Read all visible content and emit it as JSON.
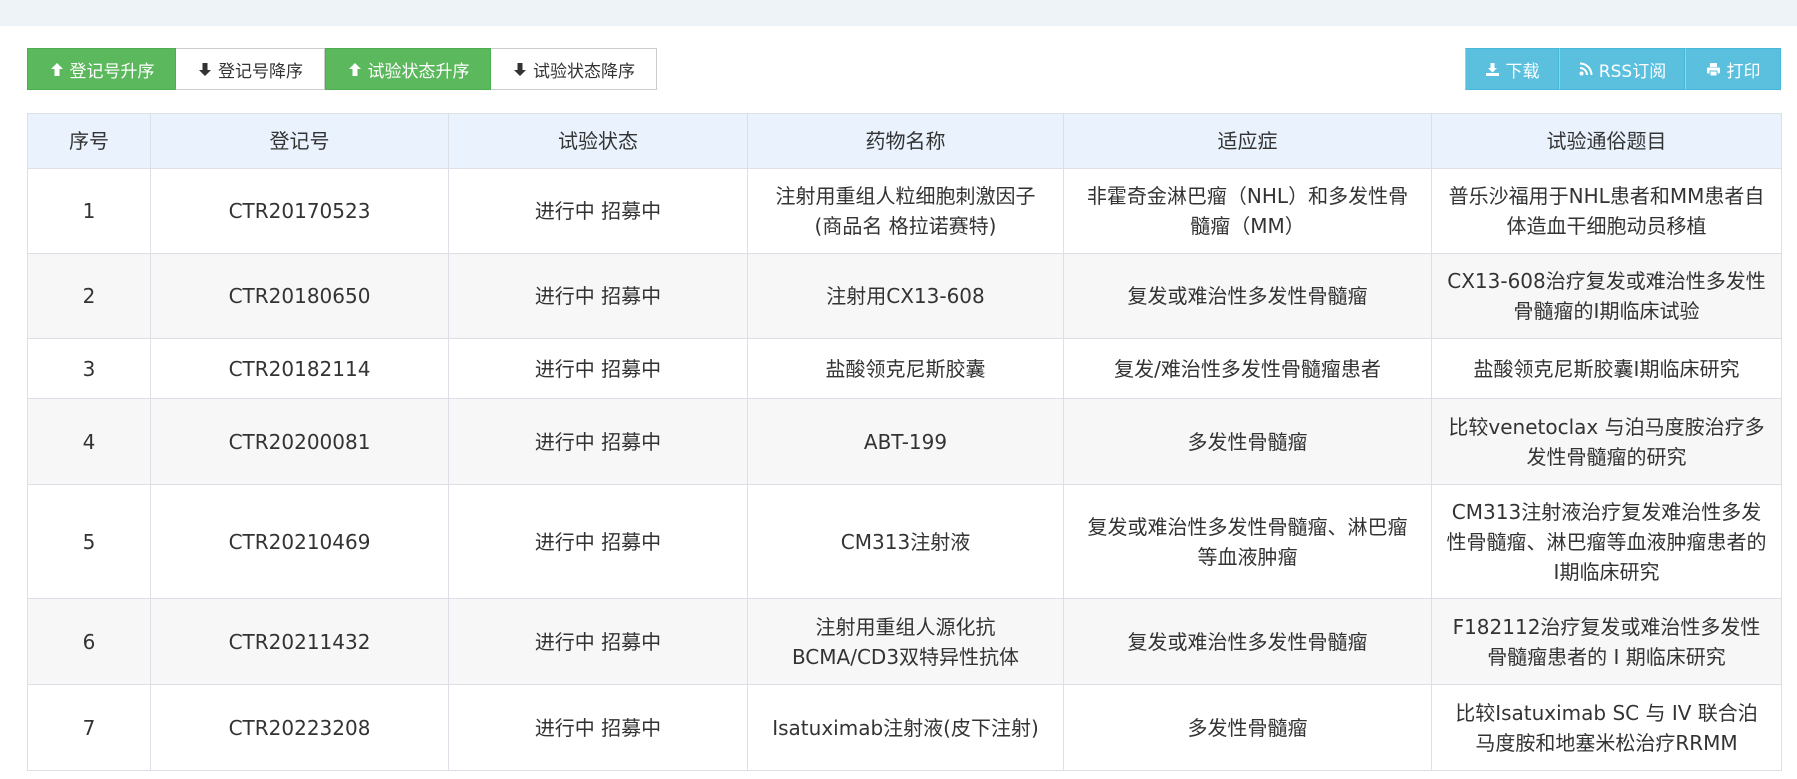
{
  "toolbar": {
    "sort_buttons": [
      {
        "label": "登记号升序",
        "icon": "arrow-up-icon",
        "active": true
      },
      {
        "label": "登记号降序",
        "icon": "arrow-down-icon",
        "active": false
      },
      {
        "label": "试验状态升序",
        "icon": "arrow-up-icon",
        "active": true
      },
      {
        "label": "试验状态降序",
        "icon": "arrow-down-icon",
        "active": false
      }
    ],
    "action_buttons": [
      {
        "label": "下载",
        "icon": "download-icon"
      },
      {
        "label": "RSS订阅",
        "icon": "rss-icon"
      },
      {
        "label": "打印",
        "icon": "print-icon"
      }
    ]
  },
  "table": {
    "headers": [
      "序号",
      "登记号",
      "试验状态",
      "药物名称",
      "适应症",
      "试验通俗题目"
    ],
    "rows": [
      {
        "no": "1",
        "reg": "CTR20170523",
        "status": "进行中 招募中",
        "drug": "注射用重组人粒细胞刺激因子(商品名 格拉诺赛特)",
        "indication": "非霍奇金淋巴瘤（NHL）和多发性骨髓瘤（MM）",
        "title": "普乐沙福用于NHL患者和MM患者自体造血干细胞动员移植"
      },
      {
        "no": "2",
        "reg": "CTR20180650",
        "status": "进行中 招募中",
        "drug": "注射用CX13-608",
        "indication": "复发或难治性多发性骨髓瘤",
        "title": "CX13-608治疗复发或难治性多发性骨髓瘤的I期临床试验"
      },
      {
        "no": "3",
        "reg": "CTR20182114",
        "status": "进行中 招募中",
        "drug": "盐酸领克尼斯胶囊",
        "indication": "复发/难治性多发性骨髓瘤患者",
        "title": "盐酸领克尼斯胶囊I期临床研究"
      },
      {
        "no": "4",
        "reg": "CTR20200081",
        "status": "进行中 招募中",
        "drug": "ABT-199",
        "indication": "多发性骨髓瘤",
        "title": "比较venetoclax 与泊马度胺治疗多发性骨髓瘤的研究"
      },
      {
        "no": "5",
        "reg": "CTR20210469",
        "status": "进行中 招募中",
        "drug": "CM313注射液",
        "indication": "复发或难治性多发性骨髓瘤、淋巴瘤等血液肿瘤",
        "title": "CM313注射液治疗复发难治性多发性骨髓瘤、淋巴瘤等血液肿瘤患者的I期临床研究"
      },
      {
        "no": "6",
        "reg": "CTR20211432",
        "status": "进行中 招募中",
        "drug": "注射用重组人源化抗BCMA/CD3双特异性抗体",
        "indication": "复发或难治性多发性骨髓瘤",
        "title": "F182112治疗复发或难治性多发性骨髓瘤患者的 I 期临床研究"
      },
      {
        "no": "7",
        "reg": "CTR20223208",
        "status": "进行中 招募中",
        "drug": "Isatuximab注射液(皮下注射)",
        "indication": "多发性骨髓瘤",
        "title": "比较Isatuximab SC 与 IV 联合泊马度胺和地塞米松治疗RRMM"
      }
    ]
  }
}
